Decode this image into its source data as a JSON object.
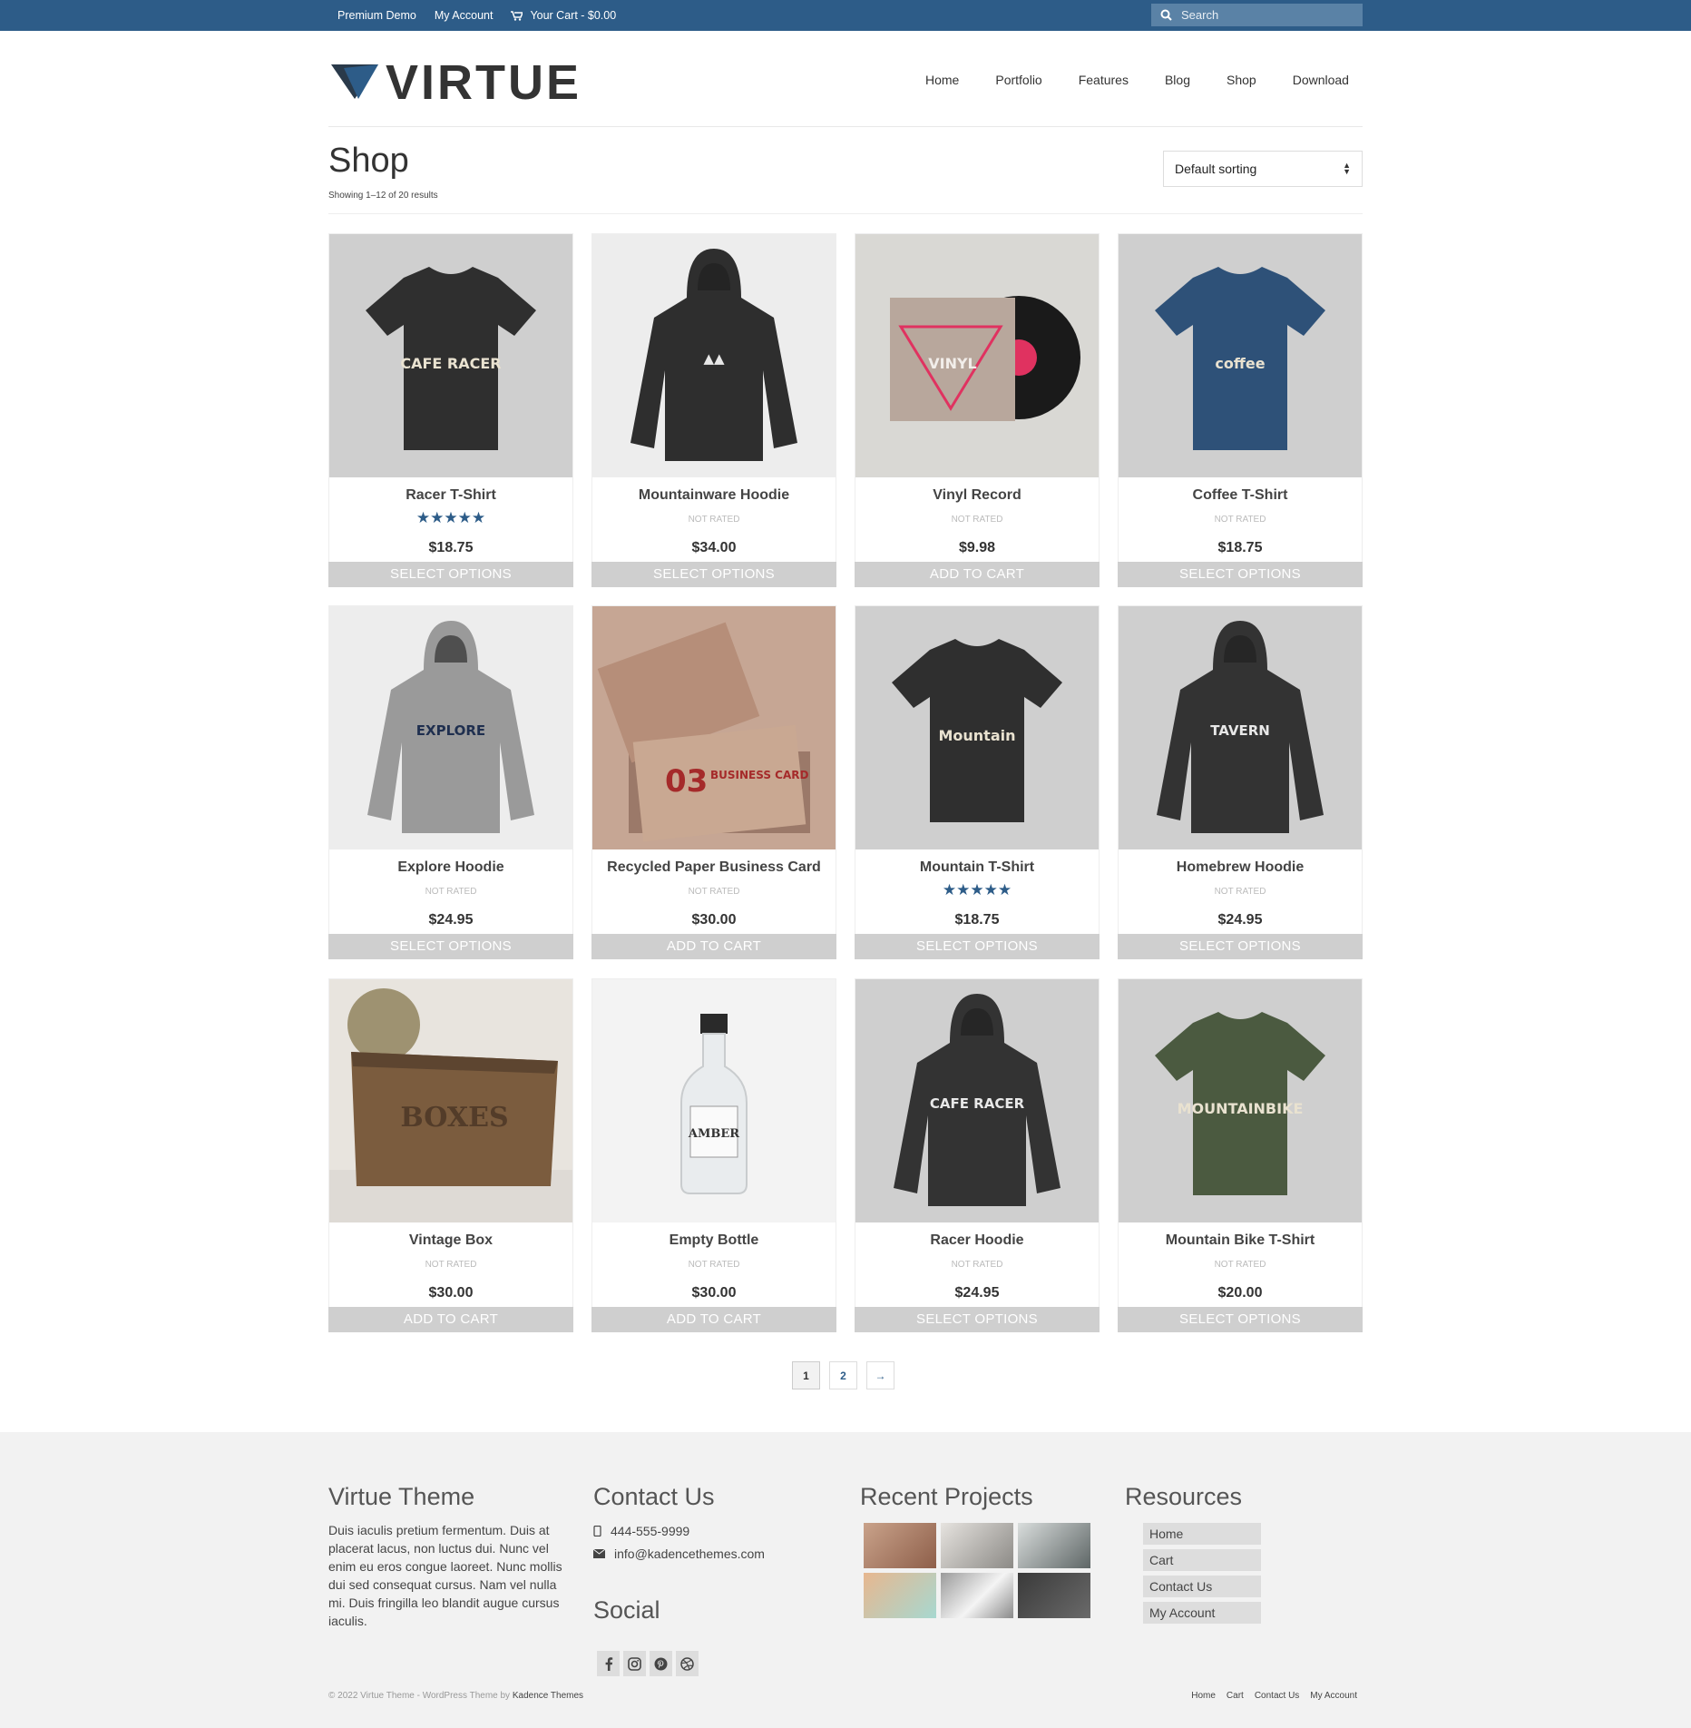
{
  "topbar": {
    "links": [
      "Premium Demo",
      "My Account"
    ],
    "cart_label": "Your Cart - $0.00",
    "search_placeholder": "Search"
  },
  "header": {
    "logo_text": "VIRTUE",
    "nav": [
      "Home",
      "Portfolio",
      "Features",
      "Blog",
      "Shop",
      "Download"
    ]
  },
  "shop": {
    "title": "Shop",
    "result_count": "Showing 1–12 of 20 results",
    "sorting": "Default sorting"
  },
  "products": [
    {
      "name": "Racer T-Shirt",
      "rating": "",
      "stars": "★★★★★",
      "price": "$18.75",
      "button": "SELECT OPTIONS",
      "image_color": "#cfcfcf",
      "kind": "tshirt-black"
    },
    {
      "name": "Mountainware Hoodie",
      "rating": "NOT RATED",
      "stars": "",
      "price": "$34.00",
      "button": "SELECT OPTIONS",
      "image_color": "#ededed",
      "kind": "hoodie-black"
    },
    {
      "name": "Vinyl Record",
      "rating": "NOT RATED",
      "stars": "",
      "price": "$9.98",
      "button": "ADD TO CART",
      "image_color": "#d9d8d4",
      "kind": "vinyl"
    },
    {
      "name": "Coffee T-Shirt",
      "rating": "NOT RATED",
      "stars": "",
      "price": "$18.75",
      "button": "SELECT OPTIONS",
      "image_color": "#cfcfcf",
      "kind": "tshirt-blue"
    },
    {
      "name": "Explore Hoodie",
      "rating": "NOT RATED",
      "stars": "",
      "price": "$24.95",
      "button": "SELECT OPTIONS",
      "image_color": "#ededed",
      "kind": "hoodie-grey"
    },
    {
      "name": "Recycled Paper Business Card",
      "rating": "NOT RATED",
      "stars": "",
      "price": "$30.00",
      "button": "ADD TO CART",
      "image_color": "#c6a694",
      "kind": "cards"
    },
    {
      "name": "Mountain T-Shirt",
      "rating": "",
      "stars": "★★★★★",
      "price": "$18.75",
      "button": "SELECT OPTIONS",
      "image_color": "#cfcfcf",
      "kind": "tshirt-black2"
    },
    {
      "name": "Homebrew Hoodie",
      "rating": "NOT RATED",
      "stars": "",
      "price": "$24.95",
      "button": "SELECT OPTIONS",
      "image_color": "#cfcfcf",
      "kind": "hoodie-black2"
    },
    {
      "name": "Vintage Box",
      "rating": "NOT RATED",
      "stars": "",
      "price": "$30.00",
      "button": "ADD TO CART",
      "image_color": "#e8e4de",
      "kind": "box"
    },
    {
      "name": "Empty Bottle",
      "rating": "NOT RATED",
      "stars": "",
      "price": "$30.00",
      "button": "ADD TO CART",
      "image_color": "#f3f3f3",
      "kind": "bottle"
    },
    {
      "name": "Racer Hoodie",
      "rating": "NOT RATED",
      "stars": "",
      "price": "$24.95",
      "button": "SELECT OPTIONS",
      "image_color": "#cfcfcf",
      "kind": "hoodie-black3"
    },
    {
      "name": "Mountain Bike T-Shirt",
      "rating": "NOT RATED",
      "stars": "",
      "price": "$20.00",
      "button": "SELECT OPTIONS",
      "image_color": "#cfcfcf",
      "kind": "tshirt-green"
    }
  ],
  "pagination": [
    "1",
    "2",
    "→"
  ],
  "footer": {
    "about_title": "Virtue Theme",
    "about_text": "Duis iaculis pretium fermentum. Duis at placerat lacus, non luctus dui. Nunc vel enim eu eros congue laoreet. Nunc mollis dui sed consequat cursus. Nam vel nulla mi. Duis fringilla leo blandit augue cursus iaculis.",
    "contact_title": "Contact Us",
    "phone": "444-555-9999",
    "email": "info@kadencethemes.com",
    "social_title": "Social",
    "projects_title": "Recent Projects",
    "resources_title": "Resources",
    "resources": [
      "Home",
      "Cart",
      "Contact Us",
      "My Account"
    ],
    "copyright": "© 2022 Virtue Theme - WordPress Theme by",
    "copyright_link": "Kadence Themes",
    "bottom_nav": [
      "Home",
      "Cart",
      "Contact Us",
      "My Account"
    ]
  },
  "colors": {
    "brand": "#2d5c88",
    "button_grey": "#cfcfcf",
    "footer_bg": "#f2f2f2"
  }
}
